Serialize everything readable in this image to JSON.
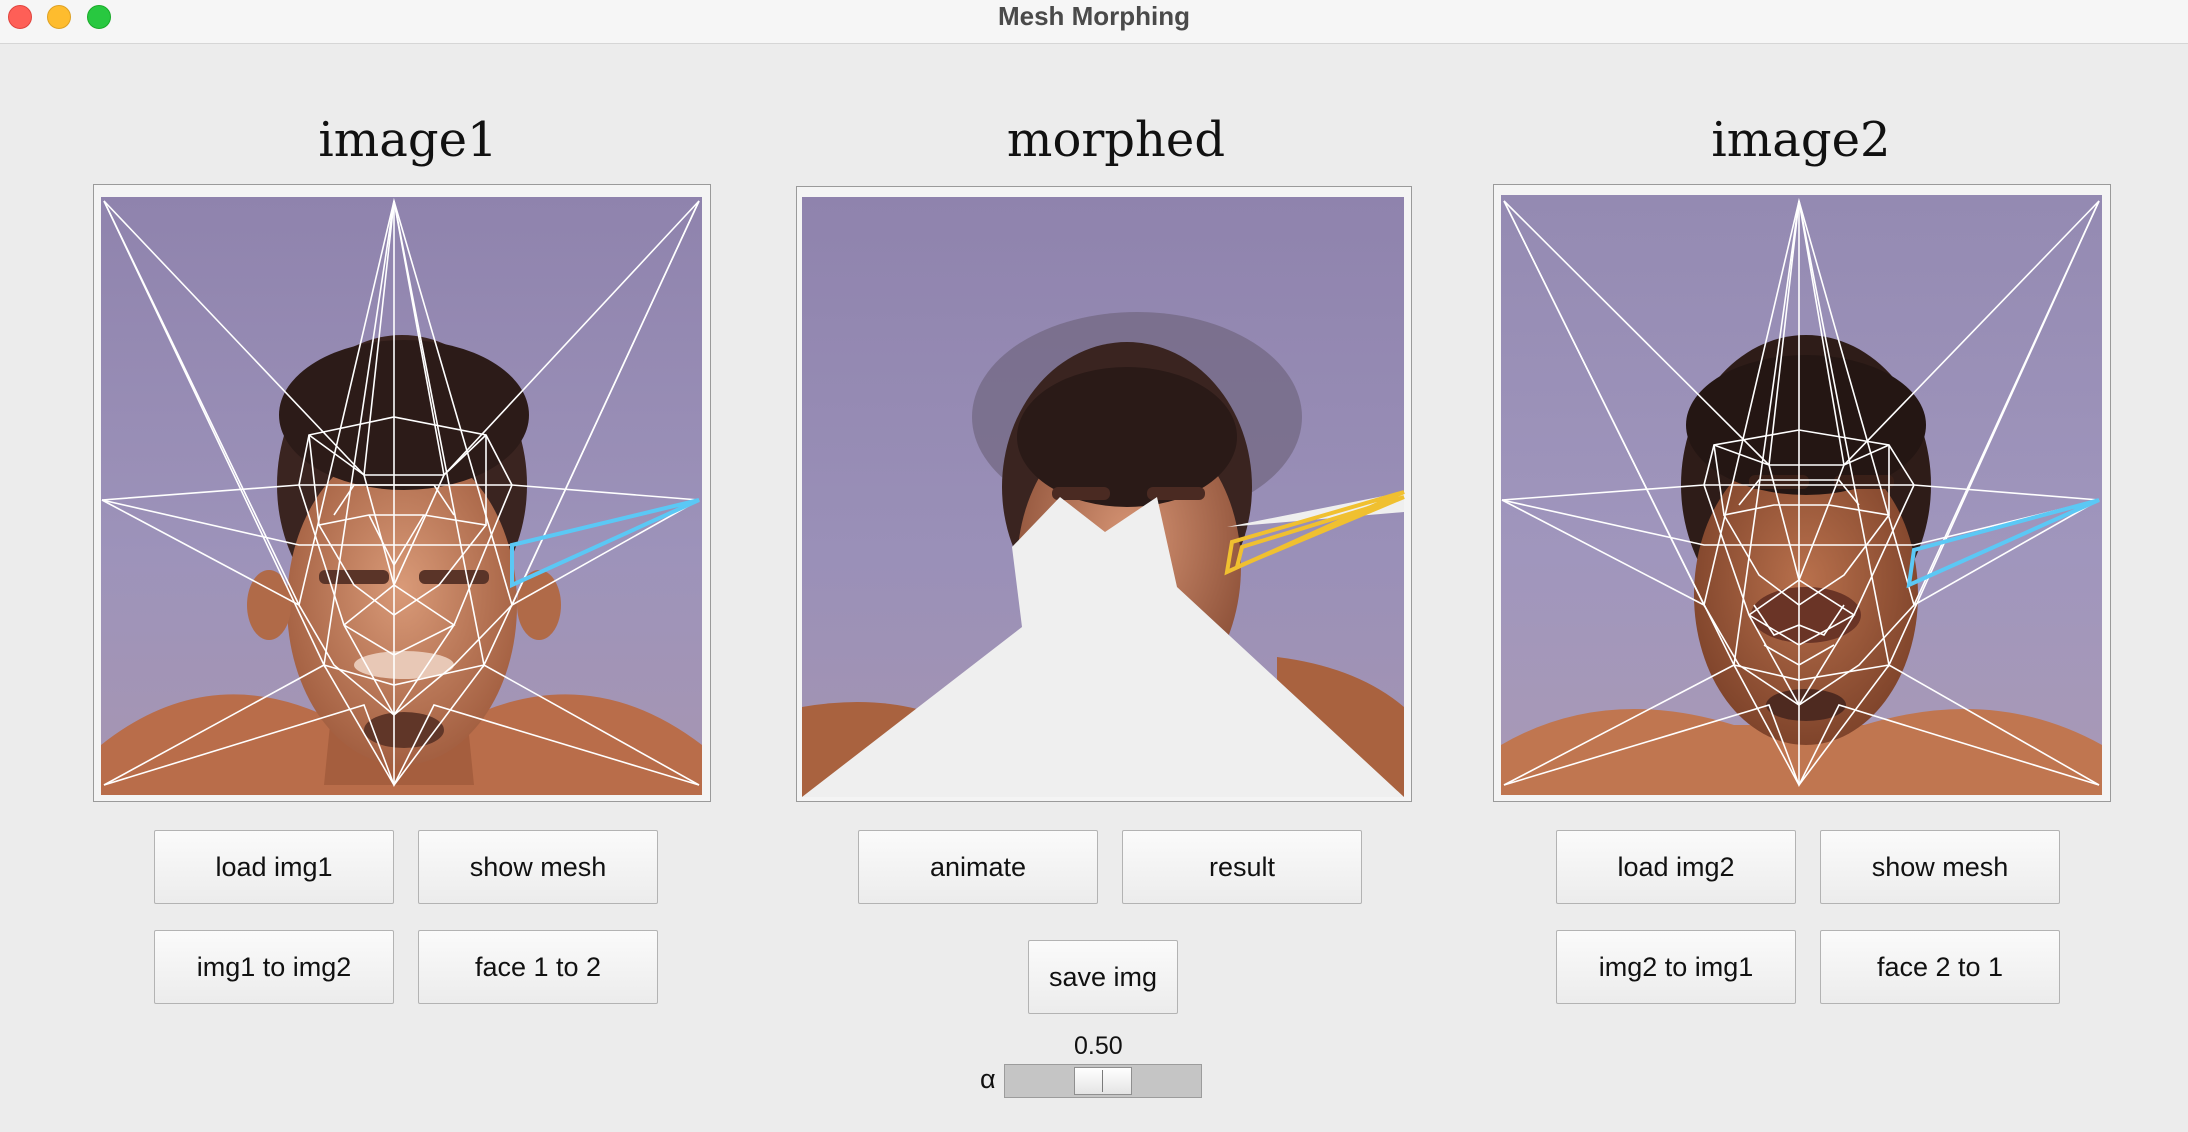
{
  "window": {
    "title": "Mesh Morphing"
  },
  "panels": {
    "left": {
      "title": "image1"
    },
    "middle": {
      "title": "morphed"
    },
    "right": {
      "title": "image2"
    }
  },
  "buttons": {
    "load_img1": "load img1",
    "show_mesh_left": "show mesh",
    "img1_to_img2": "img1 to img2",
    "face_1_to_2": "face 1 to 2",
    "animate": "animate",
    "result": "result",
    "save_img": "save img",
    "load_img2": "load img2",
    "show_mesh_right": "show mesh",
    "img2_to_img1": "img2 to img1",
    "face_2_to_1": "face 2 to 1"
  },
  "alpha": {
    "label": "α",
    "value_text": "0.50",
    "value": 0.5,
    "min": 0,
    "max": 1
  },
  "colors": {
    "mesh_line": "#ffffff",
    "highlight_triangle_source": "#5bc8f5",
    "highlight_triangle_morphed": "#f0c030",
    "background_tint": "#9b8fb8",
    "skin": "#b8714c"
  }
}
